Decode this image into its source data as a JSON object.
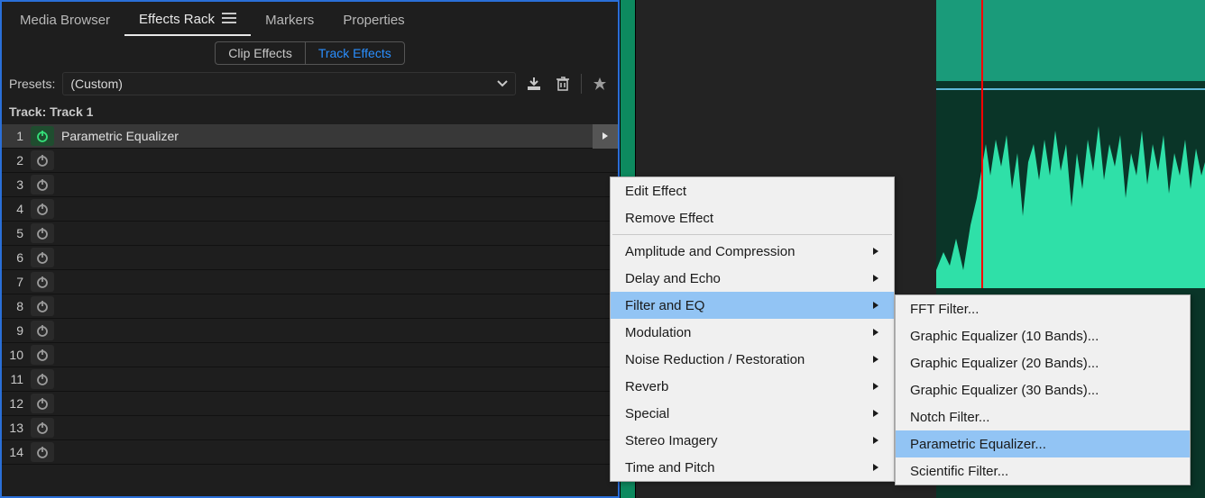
{
  "panel": {
    "tabs": [
      {
        "label": "Media Browser",
        "active": false
      },
      {
        "label": "Effects Rack",
        "active": true
      },
      {
        "label": "Markers",
        "active": false
      },
      {
        "label": "Properties",
        "active": false
      }
    ],
    "subTabs": {
      "clip": "Clip Effects",
      "track": "Track Effects"
    },
    "presetsLabel": "Presets:",
    "presetsValue": "(Custom)",
    "trackLabel": "Track: Track 1",
    "slots": [
      {
        "n": "1",
        "on": true,
        "name": "Parametric Equalizer"
      },
      {
        "n": "2",
        "on": false,
        "name": ""
      },
      {
        "n": "3",
        "on": false,
        "name": ""
      },
      {
        "n": "4",
        "on": false,
        "name": ""
      },
      {
        "n": "5",
        "on": false,
        "name": ""
      },
      {
        "n": "6",
        "on": false,
        "name": ""
      },
      {
        "n": "7",
        "on": false,
        "name": ""
      },
      {
        "n": "8",
        "on": false,
        "name": ""
      },
      {
        "n": "9",
        "on": false,
        "name": ""
      },
      {
        "n": "10",
        "on": false,
        "name": ""
      },
      {
        "n": "11",
        "on": false,
        "name": ""
      },
      {
        "n": "12",
        "on": false,
        "name": ""
      },
      {
        "n": "13",
        "on": false,
        "name": ""
      },
      {
        "n": "14",
        "on": false,
        "name": ""
      }
    ]
  },
  "contextMenu": {
    "items": [
      {
        "label": "Edit Effect",
        "submenu": false,
        "highlighted": false
      },
      {
        "label": "Remove Effect",
        "submenu": false,
        "highlighted": false
      },
      {
        "sep": true
      },
      {
        "label": "Amplitude and Compression",
        "submenu": true,
        "highlighted": false
      },
      {
        "label": "Delay and Echo",
        "submenu": true,
        "highlighted": false
      },
      {
        "label": "Filter and EQ",
        "submenu": true,
        "highlighted": true
      },
      {
        "label": "Modulation",
        "submenu": true,
        "highlighted": false
      },
      {
        "label": "Noise Reduction / Restoration",
        "submenu": true,
        "highlighted": false
      },
      {
        "label": "Reverb",
        "submenu": true,
        "highlighted": false
      },
      {
        "label": "Special",
        "submenu": true,
        "highlighted": false
      },
      {
        "label": "Stereo Imagery",
        "submenu": true,
        "highlighted": false
      },
      {
        "label": "Time and Pitch",
        "submenu": true,
        "highlighted": false
      }
    ]
  },
  "submenu": {
    "items": [
      {
        "label": "FFT Filter...",
        "highlighted": false
      },
      {
        "label": "Graphic Equalizer (10 Bands)...",
        "highlighted": false
      },
      {
        "label": "Graphic Equalizer (20 Bands)...",
        "highlighted": false
      },
      {
        "label": "Graphic Equalizer (30 Bands)...",
        "highlighted": false
      },
      {
        "label": "Notch Filter...",
        "highlighted": false
      },
      {
        "label": "Parametric Equalizer...",
        "highlighted": true
      },
      {
        "label": "Scientific Filter...",
        "highlighted": false
      }
    ]
  }
}
